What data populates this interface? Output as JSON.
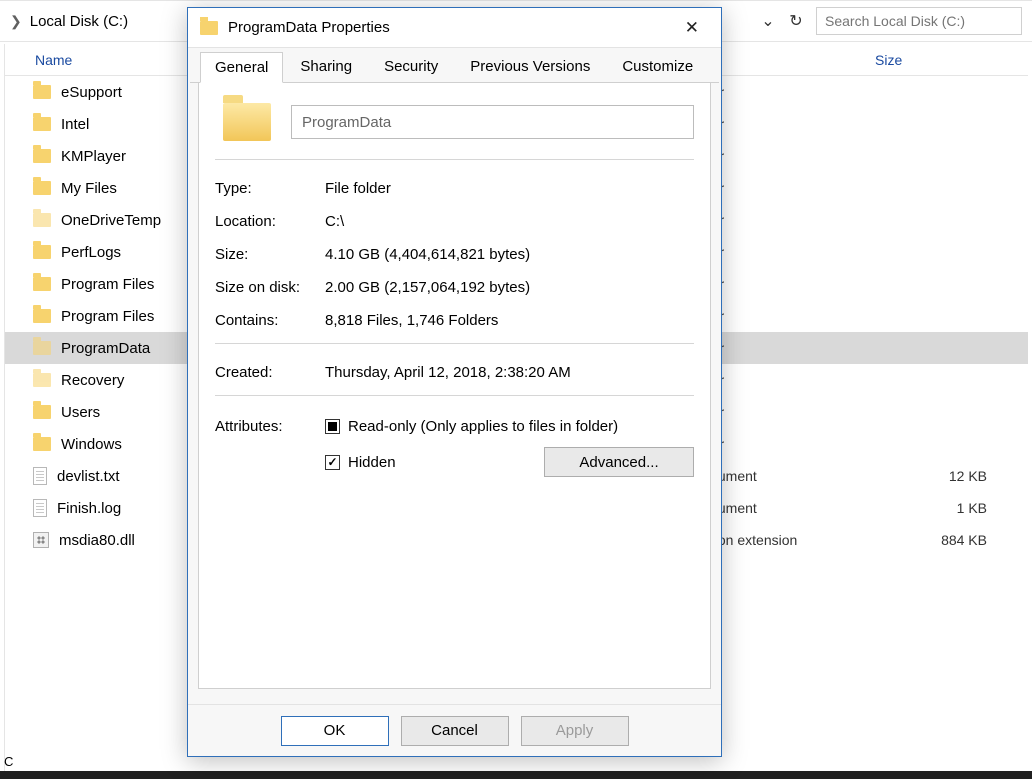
{
  "breadcrumb": {
    "label": "Local Disk (C:)"
  },
  "search": {
    "placeholder": "Search Local Disk (C:)"
  },
  "headers": {
    "name": "Name",
    "size": "Size"
  },
  "status": {
    "text": "C"
  },
  "files": [
    {
      "name": "eSupport",
      "icon": "folder",
      "type": "older",
      "size": ""
    },
    {
      "name": "Intel",
      "icon": "folder",
      "type": "older",
      "size": ""
    },
    {
      "name": "KMPlayer",
      "icon": "folder",
      "type": "older",
      "size": ""
    },
    {
      "name": "My Files",
      "icon": "folder",
      "type": "older",
      "size": ""
    },
    {
      "name": "OneDriveTemp",
      "icon": "folder-faded",
      "type": "older",
      "size": ""
    },
    {
      "name": "PerfLogs",
      "icon": "folder",
      "type": "older",
      "size": ""
    },
    {
      "name": "Program Files",
      "icon": "folder",
      "type": "older",
      "size": ""
    },
    {
      "name": "Program Files",
      "icon": "folder",
      "type": "older",
      "size": ""
    },
    {
      "name": "ProgramData",
      "icon": "folder-faded",
      "type": "older",
      "size": "",
      "selected": true
    },
    {
      "name": "Recovery",
      "icon": "folder-faded",
      "type": "older",
      "size": ""
    },
    {
      "name": "Users",
      "icon": "folder",
      "type": "older",
      "size": ""
    },
    {
      "name": "Windows",
      "icon": "folder",
      "type": "older",
      "size": ""
    },
    {
      "name": "devlist.txt",
      "icon": "file",
      "type": "Document",
      "size": "12 KB"
    },
    {
      "name": "Finish.log",
      "icon": "file",
      "type": "Document",
      "size": "1 KB"
    },
    {
      "name": "msdia80.dll",
      "icon": "dll",
      "type": "ication extension",
      "size": "884 KB"
    }
  ],
  "dialog": {
    "title": "ProgramData Properties",
    "tabs": [
      "General",
      "Sharing",
      "Security",
      "Previous Versions",
      "Customize"
    ],
    "folder_name": "ProgramData",
    "rows": {
      "type_label": "Type:",
      "type_val": "File folder",
      "loc_label": "Location:",
      "loc_val": "C:\\",
      "size_label": "Size:",
      "size_val": "4.10 GB (4,404,614,821 bytes)",
      "sod_label": "Size on disk:",
      "sod_val": "2.00 GB (2,157,064,192 bytes)",
      "con_label": "Contains:",
      "con_val": "8,818 Files, 1,746 Folders",
      "cre_label": "Created:",
      "cre_val": "Thursday, April 12, 2018, 2:38:20 AM",
      "attr_label": "Attributes:",
      "ro_label": "Read-only (Only applies to files in folder)",
      "hid_label": "Hidden",
      "adv_label": "Advanced..."
    },
    "buttons": {
      "ok": "OK",
      "cancel": "Cancel",
      "apply": "Apply"
    }
  }
}
